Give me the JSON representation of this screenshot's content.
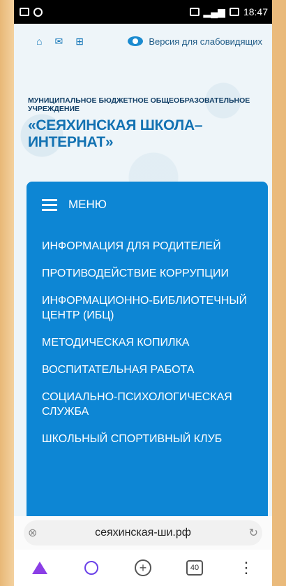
{
  "status_bar": {
    "time": "18:47",
    "left_icons": [
      "image-icon",
      "at-icon"
    ],
    "right_icons": [
      "cast-icon",
      "signal-icon",
      "network-icon",
      "battery-icon"
    ]
  },
  "site_header": {
    "top_icons": [
      "home-icon",
      "mail-icon",
      "sitemap-icon"
    ],
    "vision_link": "Версия для слабовидящих",
    "org_type": "МУНИЦИПАЛЬНОЕ БЮДЖЕТНОЕ ОБЩЕОБРАЗОВАТЕЛЬНОЕ УЧРЕЖДЕНИЕ",
    "school_name": "«СЕЯХИНСКАЯ ШКОЛА– ИНТЕРНАТ»"
  },
  "menu": {
    "title": "МЕНЮ",
    "items": [
      "ИНФОРМАЦИЯ ДЛЯ РОДИТЕЛЕЙ",
      "ПРОТИВОДЕЙСТВИЕ КОРРУПЦИИ",
      "ИНФОРМАЦИОННО-БИБЛИОТЕЧНЫЙ ЦЕНТР (ИБЦ)",
      "МЕТОДИЧЕСКАЯ КОПИЛКА",
      "ВОСПИТАТЕЛЬНАЯ РАБОТА",
      "СОЦИАЛЬНО-ПСИХОЛОГИЧЕСКАЯ СЛУЖБА",
      "ШКОЛЬНЫЙ СПОРТИВНЫЙ КЛУБ"
    ]
  },
  "browser": {
    "url": "сеяхинская-ши.рф",
    "tab_count": "40"
  },
  "colors": {
    "menu_bg": "#0d86d4",
    "accent": "#1372b2"
  }
}
